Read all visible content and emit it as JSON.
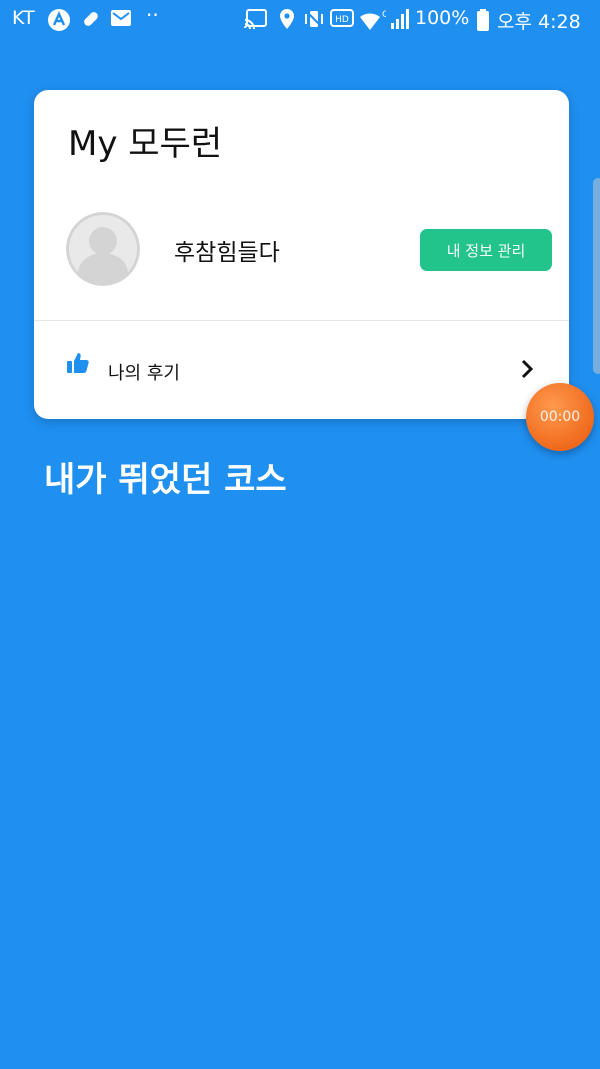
{
  "status_bar": {
    "carrier": "KT",
    "battery_percent": "100%",
    "time": "오후 4:28",
    "icons": [
      "a-app-icon",
      "pill-icon",
      "mail-icon",
      "more-dots-icon",
      "cast-icon",
      "location-icon",
      "vibrate-mute-icon",
      "hd-icon",
      "wifi-icon",
      "signal-icon",
      "battery-icon"
    ]
  },
  "card": {
    "title": "My 모두런",
    "profile": {
      "username": "후참힘들다",
      "manage_button_label": "내 정보 관리"
    },
    "reviews": {
      "label": "나의 후기"
    }
  },
  "timer": {
    "value": "00:00"
  },
  "courses": {
    "title": "내가 뛰었던 코스"
  },
  "colors": {
    "background": "#1f8ff0",
    "accent_green": "#22c48b",
    "thumb_blue": "#1f8ff0",
    "timer_orange": "#f06a1d"
  }
}
